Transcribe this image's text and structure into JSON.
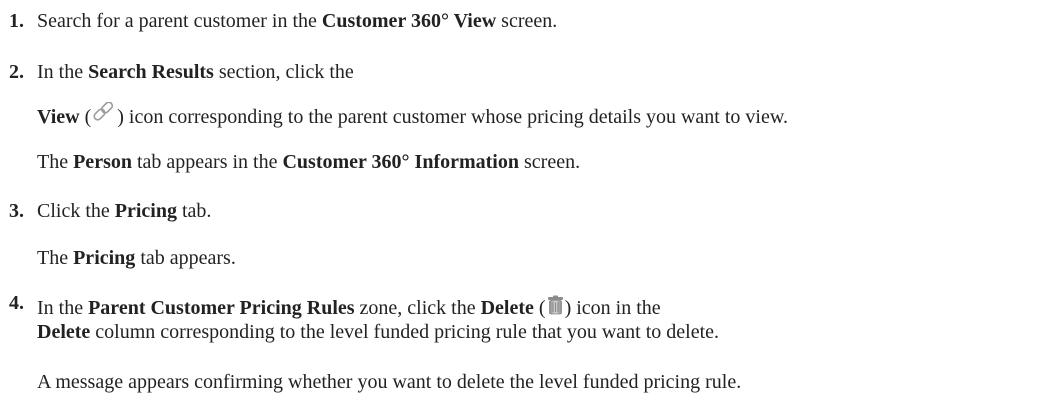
{
  "steps": [
    {
      "number": "1.",
      "lines": [
        {
          "a": "Search for a parent customer in the ",
          "b": "Customer 360° View",
          "c": " screen."
        }
      ]
    },
    {
      "number": "2.",
      "lines": [
        {
          "a": "In the ",
          "b": "Search Results",
          "c": " section, click the"
        },
        {
          "b": "View",
          "a": " (",
          "icon": "link-icon",
          "c": ") icon corresponding to the parent customer whose pricing details you want to view."
        },
        {
          "a": "The ",
          "b": "Person",
          "c": " tab appears in the ",
          "d": "Customer 360° Information",
          "e": " screen."
        }
      ]
    },
    {
      "number": "3.",
      "lines": [
        {
          "a": "Click the ",
          "b": "Pricing",
          "c": " tab."
        },
        {
          "a": "The ",
          "b": "Pricing",
          "c": " tab appears."
        }
      ]
    },
    {
      "number": "4.",
      "lines": [
        {
          "a": "In the ",
          "b": "Parent Customer Pricing Rules",
          "c": " zone, click the ",
          "d": "Delete",
          "e": " (",
          "icon": "trash-icon",
          "f": ") icon in the"
        },
        {
          "b": "Delete",
          "c": " column corresponding to the level funded pricing rule that you want to delete."
        },
        {
          "a": "A message appears confirming whether you want to delete the level funded pricing rule."
        }
      ]
    }
  ]
}
